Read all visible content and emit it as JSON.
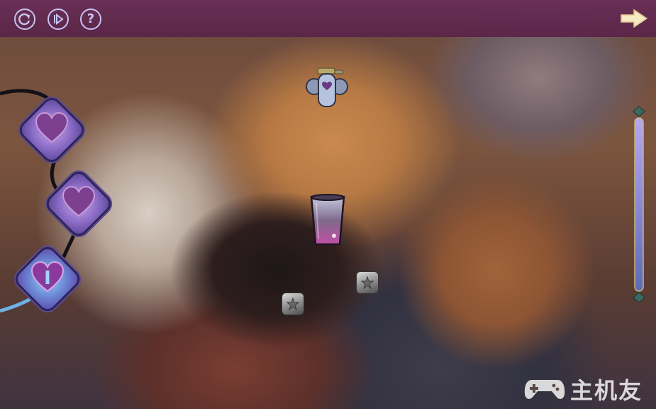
{
  "toolbar": {
    "buttons": [
      {
        "name": "restart",
        "icon": "restart-icon"
      },
      {
        "name": "play",
        "icon": "play-icon"
      },
      {
        "name": "help",
        "icon": "help-icon",
        "glyph": "?"
      }
    ],
    "next_icon": "arrow-right-icon",
    "bar_color": "#5a2448",
    "icon_color": "#c7c3f2"
  },
  "level_path": {
    "nodes": [
      {
        "icon": "heart-icon",
        "label": "",
        "state": "locked"
      },
      {
        "icon": "heart-icon",
        "label": "",
        "state": "locked"
      },
      {
        "icon": "heart-icon",
        "label": "I",
        "state": "current"
      }
    ]
  },
  "meter": {
    "icon": "vertical-slider",
    "fill_color": "#8c8de0"
  },
  "playfield": {
    "potion_icon": "potion-bottle-icon",
    "cup_icon": "drinking-glass-icon",
    "star_blocks": [
      {
        "icon": "star-icon"
      },
      {
        "icon": "star-icon"
      }
    ]
  },
  "watermark": {
    "logo_icon": "gamepad-icon",
    "text": "主机友"
  }
}
